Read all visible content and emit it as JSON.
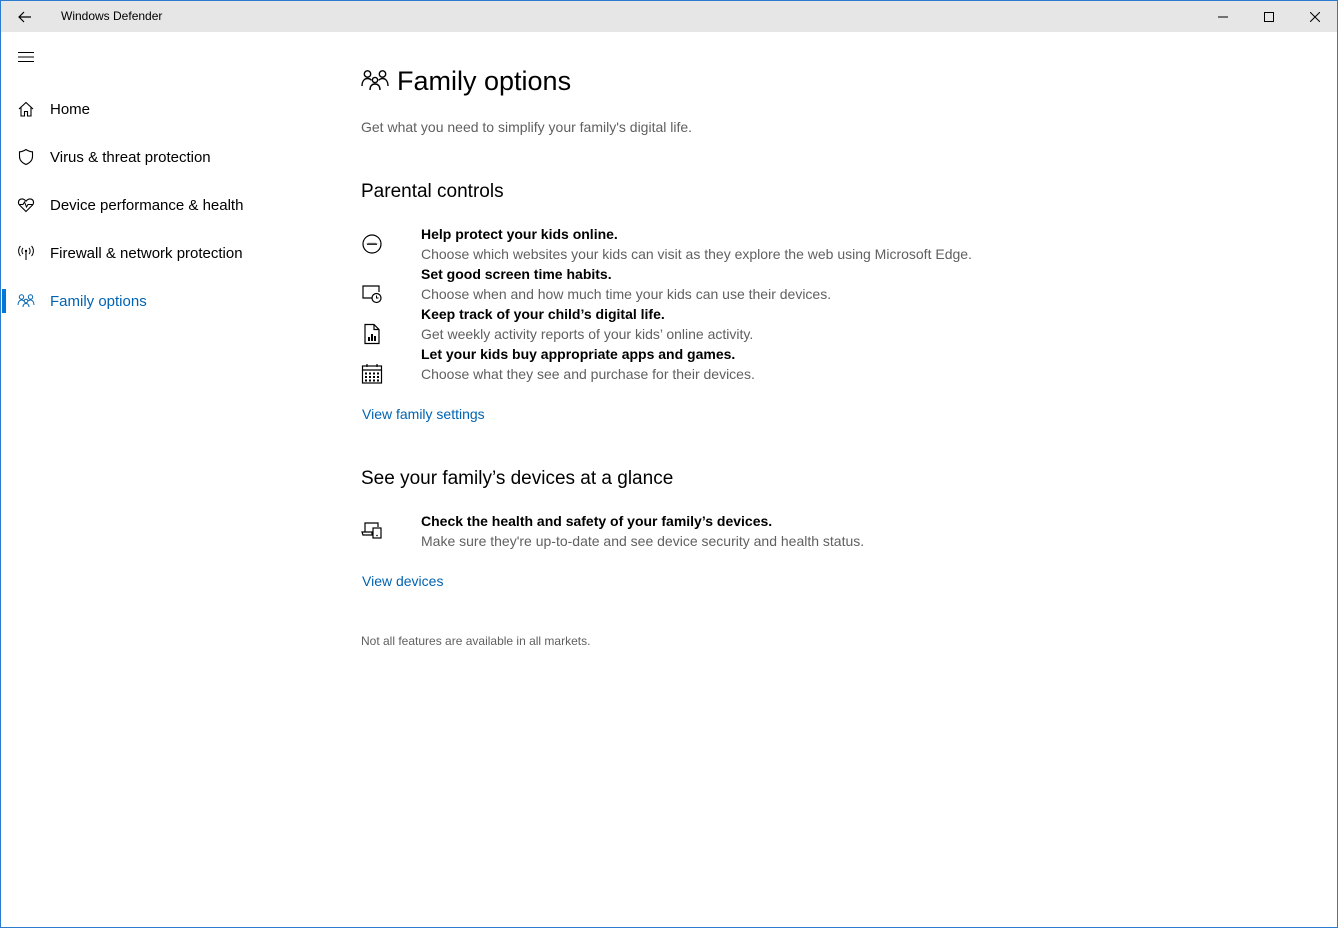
{
  "app": {
    "title": "Windows Defender",
    "accent_color": "#0078d7",
    "link_color": "#0063b1"
  },
  "titlebar": {
    "back_icon": "arrow-left-icon",
    "minimize_icon": "minimize-icon",
    "maximize_icon": "maximize-icon",
    "close_icon": "close-icon"
  },
  "sidebar": {
    "menu_icon": "hamburger-icon",
    "items": [
      {
        "label": "Home",
        "icon": "home-icon",
        "active": false
      },
      {
        "label": "Virus & threat protection",
        "icon": "shield-icon",
        "active": false
      },
      {
        "label": "Device performance & health",
        "icon": "heart-icon",
        "active": false
      },
      {
        "label": "Firewall & network protection",
        "icon": "antenna-icon",
        "active": false
      },
      {
        "label": "Family options",
        "icon": "family-icon",
        "active": true
      }
    ]
  },
  "main": {
    "title": "Family options",
    "title_icon": "family-icon",
    "subtitle": "Get what you need to simplify your family's digital life.",
    "parental": {
      "heading": "Parental controls",
      "features": [
        {
          "icon": "emoji-face-icon",
          "title": "Help protect your kids online.",
          "desc": "Choose which websites your kids can visit as they explore the web using Microsoft Edge."
        },
        {
          "icon": "screen-clock-icon",
          "title": "Set good screen time habits.",
          "desc": "Choose when and how much time your kids can use their devices."
        },
        {
          "icon": "report-icon",
          "title": "Keep track of your child’s digital life.",
          "desc": "Get weekly activity reports of your kids’ online activity."
        },
        {
          "icon": "calendar-icon",
          "title": "Let your kids buy appropriate apps and games.",
          "desc": "Choose what they see and purchase for their devices."
        }
      ],
      "link": "View family settings"
    },
    "devices": {
      "heading": "See your family’s devices at a glance",
      "features": [
        {
          "icon": "devices-icon",
          "title": "Check the health and safety of your family’s devices.",
          "desc": "Make sure they're up-to-date and see device security and health status."
        }
      ],
      "link": "View devices"
    },
    "footnote": "Not all features are available in all markets."
  }
}
